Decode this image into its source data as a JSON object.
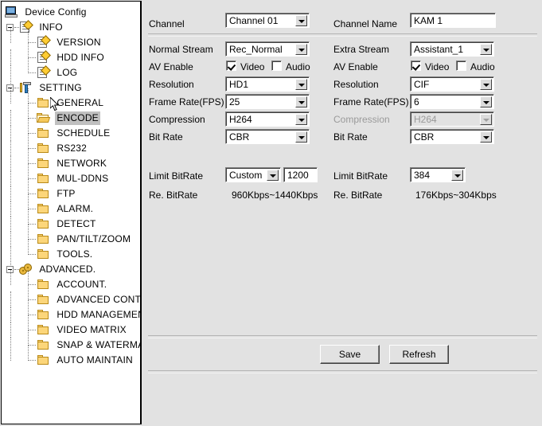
{
  "tree": {
    "root": {
      "label": "Device Config",
      "icon": "computer-icon"
    },
    "groups": [
      {
        "label": "INFO",
        "icon": "document-pencil-icon",
        "expanded": true,
        "children": [
          {
            "label": "VERSION",
            "icon": "document-pencil-icon"
          },
          {
            "label": "HDD INFO",
            "icon": "document-pencil-icon"
          },
          {
            "label": "LOG",
            "icon": "document-pencil-icon"
          }
        ]
      },
      {
        "label": "SETTING",
        "icon": "tools-icon",
        "expanded": true,
        "children": [
          {
            "label": "GENERAL",
            "icon": "folder-icon",
            "selected": false
          },
          {
            "label": "ENCODE",
            "icon": "folder-open-icon",
            "selected": true
          },
          {
            "label": "SCHEDULE",
            "icon": "folder-icon",
            "selected": false
          },
          {
            "label": "RS232",
            "icon": "folder-icon",
            "selected": false
          },
          {
            "label": "NETWORK",
            "icon": "folder-icon",
            "selected": false
          },
          {
            "label": "MUL-DDNS",
            "icon": "folder-icon",
            "selected": false
          },
          {
            "label": "FTP",
            "icon": "folder-icon",
            "selected": false
          },
          {
            "label": "ALARM.",
            "icon": "folder-icon",
            "selected": false
          },
          {
            "label": "DETECT",
            "icon": "folder-icon",
            "selected": false
          },
          {
            "label": "PAN/TILT/ZOOM",
            "icon": "folder-icon",
            "selected": false
          },
          {
            "label": "TOOLS.",
            "icon": "folder-icon",
            "selected": false
          }
        ]
      },
      {
        "label": "ADVANCED.",
        "icon": "gears-icon",
        "expanded": true,
        "children": [
          {
            "label": "ACCOUNT.",
            "icon": "folder-icon"
          },
          {
            "label": "ADVANCED CONTROL.",
            "icon": "folder-icon"
          },
          {
            "label": "HDD MANAGEMENT",
            "icon": "folder-icon"
          },
          {
            "label": "VIDEO MATRIX",
            "icon": "folder-icon"
          },
          {
            "label": "SNAP & WATERMARK",
            "icon": "folder-icon"
          },
          {
            "label": "AUTO MAINTAIN",
            "icon": "folder-icon"
          }
        ]
      }
    ]
  },
  "form": {
    "channel": {
      "label": "Channel",
      "value": "Channel  01"
    },
    "channel_name": {
      "label": "Channel Name",
      "value": "KAM 1"
    },
    "left": {
      "stream": {
        "label": "Normal Stream",
        "value": "Rec_Normal"
      },
      "av_enable": {
        "label": "AV Enable",
        "video_label": "Video",
        "video_checked": true,
        "audio_label": "Audio",
        "audio_checked": false
      },
      "resolution": {
        "label": "Resolution",
        "value": "HD1"
      },
      "frame_rate": {
        "label": "Frame Rate(FPS)",
        "value": "25"
      },
      "compression": {
        "label": "Compression",
        "value": "H264",
        "disabled": false
      },
      "bit_rate": {
        "label": "Bit Rate",
        "value": "CBR"
      },
      "limit_bitrate": {
        "label": "Limit BitRate",
        "value": "Custom",
        "custom_value": "1200"
      },
      "re_bitrate": {
        "label": "Re. BitRate",
        "value": "960Kbps~1440Kbps"
      }
    },
    "right": {
      "stream": {
        "label": "Extra Stream",
        "value": "Assistant_1"
      },
      "av_enable": {
        "label": "AV Enable",
        "video_label": "Video",
        "video_checked": true,
        "audio_label": "Audio",
        "audio_checked": false
      },
      "resolution": {
        "label": "Resolution",
        "value": "CIF"
      },
      "frame_rate": {
        "label": "Frame Rate(FPS)",
        "value": "6"
      },
      "compression": {
        "label": "Compression",
        "value": "H264",
        "disabled": true
      },
      "bit_rate": {
        "label": "Bit Rate",
        "value": "CBR"
      },
      "limit_bitrate": {
        "label": "Limit BitRate",
        "value": "384"
      },
      "re_bitrate": {
        "label": "Re. BitRate",
        "value": "176Kbps~304Kbps"
      }
    },
    "actions": {
      "save": "Save",
      "refresh": "Refresh"
    }
  },
  "colors": {
    "panel_bg": "#e2e2e2",
    "tree_bg": "#ffffff",
    "selection": "#c0c0c0",
    "folder": "#fcd67a"
  }
}
